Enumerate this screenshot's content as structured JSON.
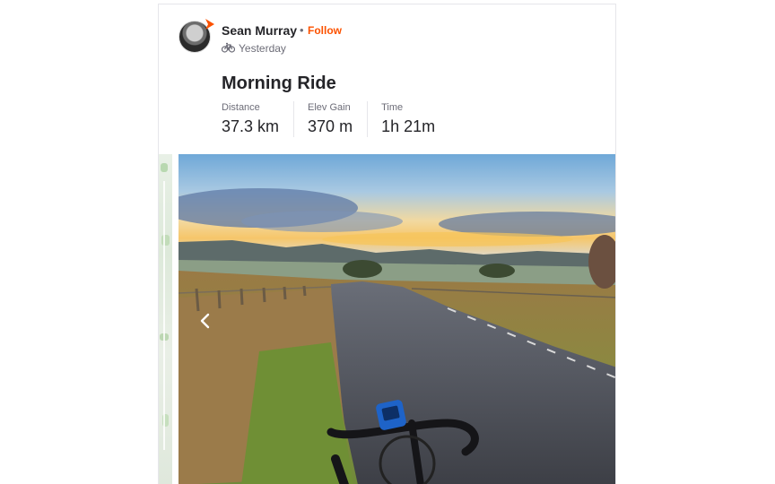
{
  "activity": {
    "athlete_name": "Sean Murray",
    "separator": "•",
    "follow_label": "Follow",
    "timestamp": "Yesterday",
    "title": "Morning Ride",
    "stats": [
      {
        "label": "Distance",
        "value": "37.3 km"
      },
      {
        "label": "Elev Gain",
        "value": "370 m"
      },
      {
        "label": "Time",
        "value": "1h 21m"
      }
    ]
  },
  "colors": {
    "accent": "#fc5200",
    "text_primary": "#242428",
    "text_secondary": "#6d6d78"
  },
  "icons": {
    "activity_type": "bike-icon",
    "carousel_prev": "chevron-left-icon"
  }
}
